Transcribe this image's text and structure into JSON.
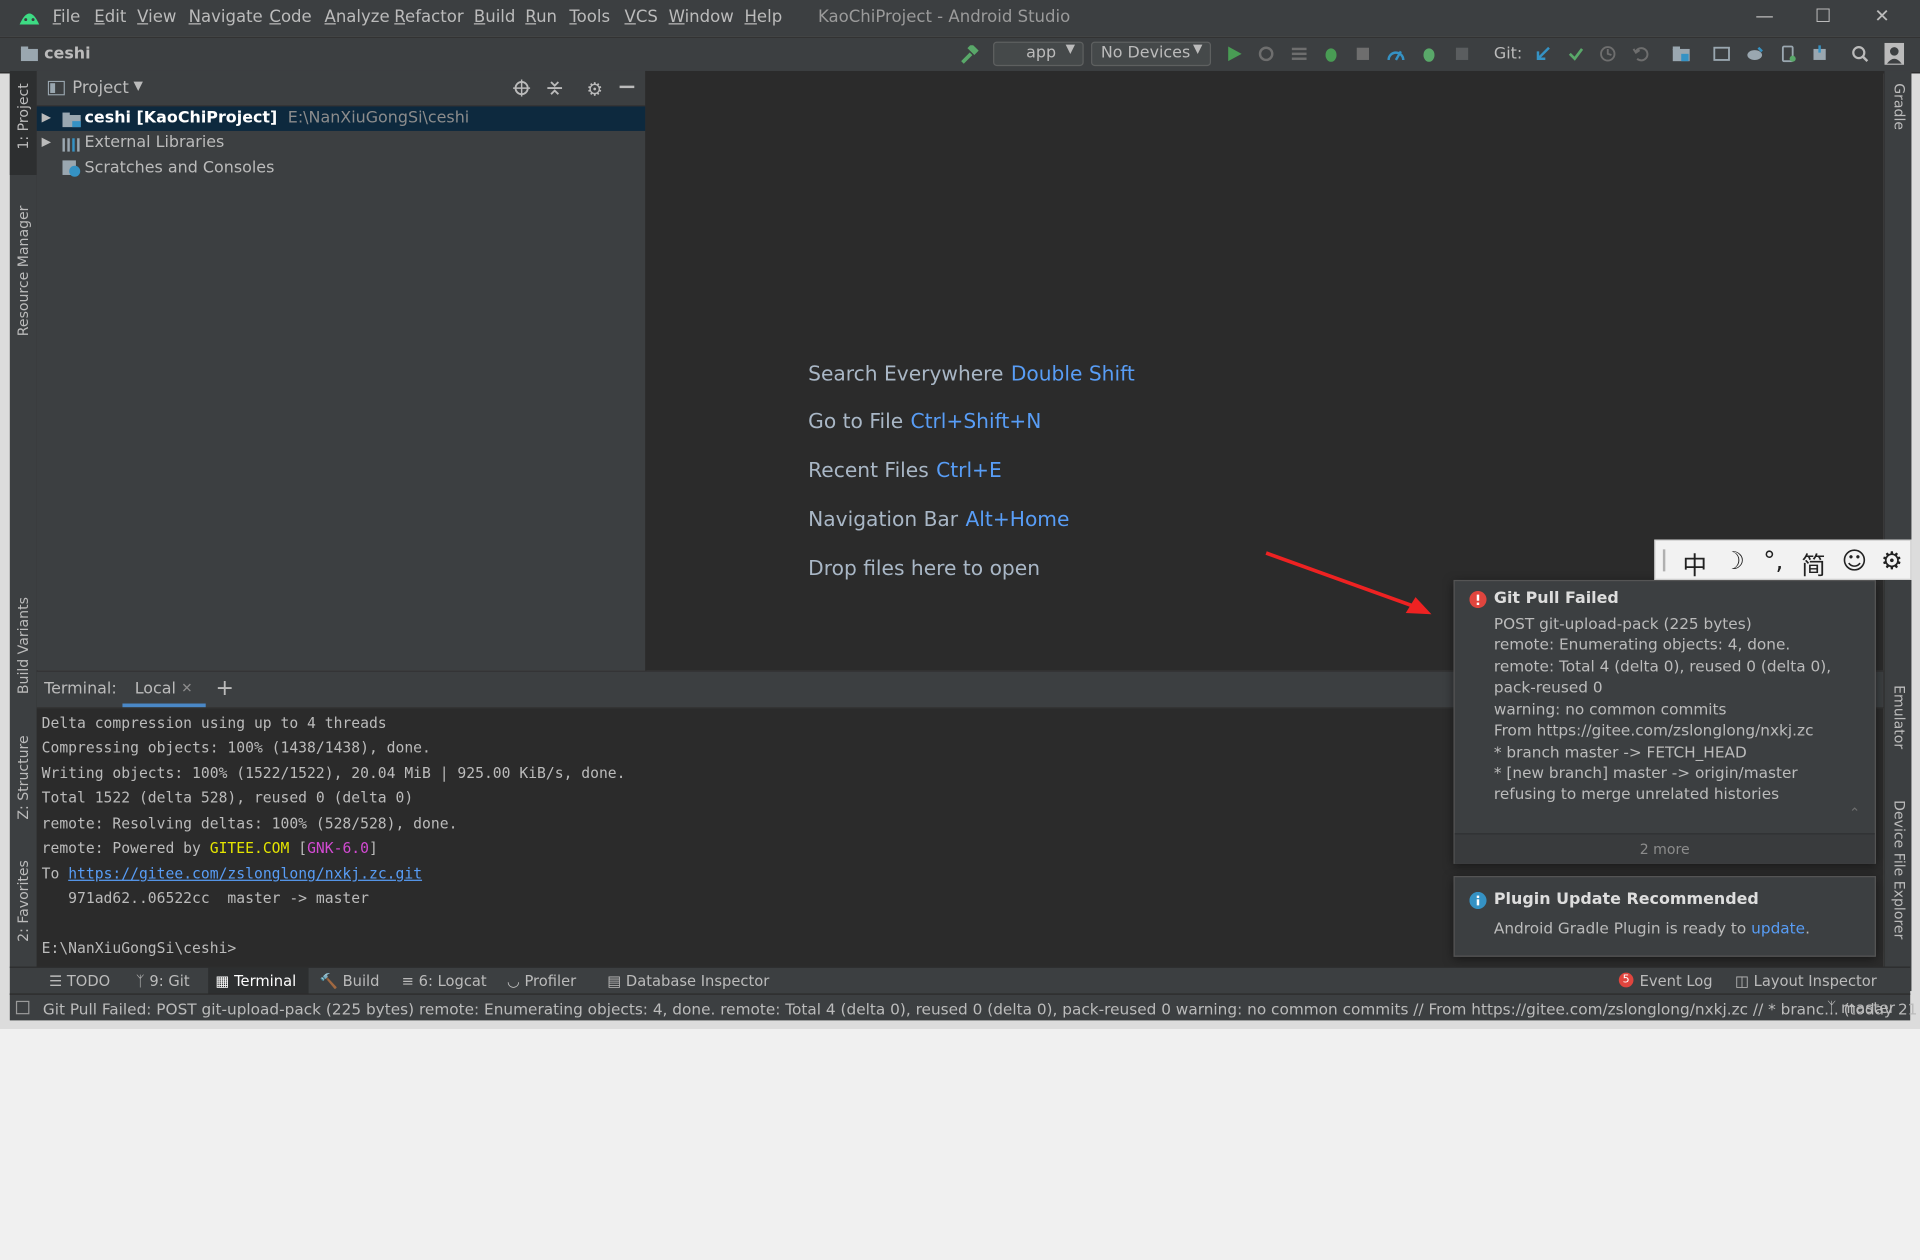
{
  "menubar": {
    "items": [
      "File",
      "Edit",
      "View",
      "Navigate",
      "Code",
      "Analyze",
      "Refactor",
      "Build",
      "Run",
      "Tools",
      "VCS",
      "Window",
      "Help"
    ],
    "window_title": "KaoChiProject - Android Studio",
    "icons": {
      "logo": "android-studio-logo-icon",
      "minimize": "minimize-icon",
      "maximize": "maximize-icon",
      "close": "close-icon"
    }
  },
  "toolbar": {
    "breadcrumb": "ceshi",
    "run_config": "app",
    "device": "No Devices",
    "git_label": "Git:",
    "icons": [
      "hammer-icon",
      "run-icon",
      "rerun-icon",
      "apply-changes-icon",
      "debug-icon",
      "attach-debugger-icon",
      "profile-icon",
      "debug-bug-icon",
      "stop-icon",
      "git-update-icon",
      "git-commit-icon",
      "git-history-icon",
      "git-rollback-icon",
      "project-structure-icon",
      "avd-manager-icon",
      "sync-gradle-icon",
      "device-manager-icon",
      "sdk-manager-icon",
      "search-icon",
      "account-icon"
    ]
  },
  "left_strip": {
    "tabs": [
      "1: Project",
      "Resource Manager",
      "Build Variants",
      "Z: Structure",
      "2: Favorites"
    ]
  },
  "right_strip": {
    "tabs": [
      "Gradle",
      "Emulator",
      "Device File Explorer"
    ]
  },
  "project_panel": {
    "title": "Project",
    "tree": [
      {
        "name": "ceshi [KaoChiProject]",
        "path": "E:\\NanXiuGongSi\\ceshi",
        "selected": true
      },
      {
        "name": "External Libraries"
      },
      {
        "name": "Scratches and Consoles"
      }
    ]
  },
  "editor": {
    "hints": [
      {
        "label": "Search Everywhere",
        "key": "Double Shift"
      },
      {
        "label": "Go to File",
        "key": "Ctrl+Shift+N"
      },
      {
        "label": "Recent Files",
        "key": "Ctrl+E"
      },
      {
        "label": "Navigation Bar",
        "key": "Alt+Home"
      },
      {
        "label": "Drop files here to open",
        "key": ""
      }
    ]
  },
  "terminal": {
    "label": "Terminal:",
    "tab": "Local",
    "lines": [
      "Delta compression using up to 4 threads",
      "Compressing objects: 100% (1438/1438), done.",
      "Writing objects: 100% (1522/1522), 20.04 MiB | 925.00 KiB/s, done.",
      "Total 1522 (delta 528), reused 0 (delta 0)",
      "remote: Resolving deltas: 100% (528/528), done."
    ],
    "powered_prefix": "remote: Powered by ",
    "powered_gitee": "GITEE.COM",
    "powered_open": " [",
    "powered_gnk": "GNK-6.0",
    "powered_close": "]",
    "to_prefix": "To ",
    "to_url": "https://gitee.com/zslonglong/nxkj.zc.git",
    "ref_line": "   971ad62..06522cc  master -> master",
    "prompt": "E:\\NanXiuGongSi\\ceshi>"
  },
  "bottom_tools": {
    "left": [
      "TODO",
      "9: Git",
      "Terminal",
      "Build",
      "6: Logcat",
      "Profiler",
      "Database Inspector"
    ],
    "right": [
      "Event Log",
      "Layout Inspector"
    ],
    "event_badge": "5"
  },
  "status_bar": {
    "text": "Git Pull Failed: POST git-upload-pack (225 bytes) remote: Enumerating objects: 4, done. remote: Total 4 (delta 0), reused 0 (delta 0), pack-reused 0 warning: no common commits // From https://gitee.com/zslonglong/nxkj.zc // * branc... (today 21",
    "branch": "master"
  },
  "notifications": {
    "git_pull": {
      "title": "Git Pull Failed",
      "lines": [
        "POST git-upload-pack (225 bytes)",
        "remote: Enumerating objects: 4, done.",
        "remote: Total 4 (delta 0), reused 0 (delta 0),",
        "pack-reused 0",
        "warning: no common commits",
        "From https://gitee.com/zslonglong/nxkj.zc",
        "* branch master -> FETCH_HEAD",
        "* [new branch] master -> origin/master",
        "refusing to merge unrelated histories"
      ],
      "more": "2 more"
    },
    "plugin": {
      "title": "Plugin Update Recommended",
      "text": "Android Gradle Plugin is ready to ",
      "link": "update",
      "end": "."
    }
  },
  "ime": {
    "items": [
      "中",
      "☽",
      "°,",
      "简",
      "☺",
      "⚙"
    ]
  },
  "colors": {
    "link": "#589df6",
    "error": "#e0453e",
    "info": "#3592c4",
    "gitee": "#e5e500",
    "gnk": "#d24ad2",
    "arrow": "#ee2222"
  }
}
